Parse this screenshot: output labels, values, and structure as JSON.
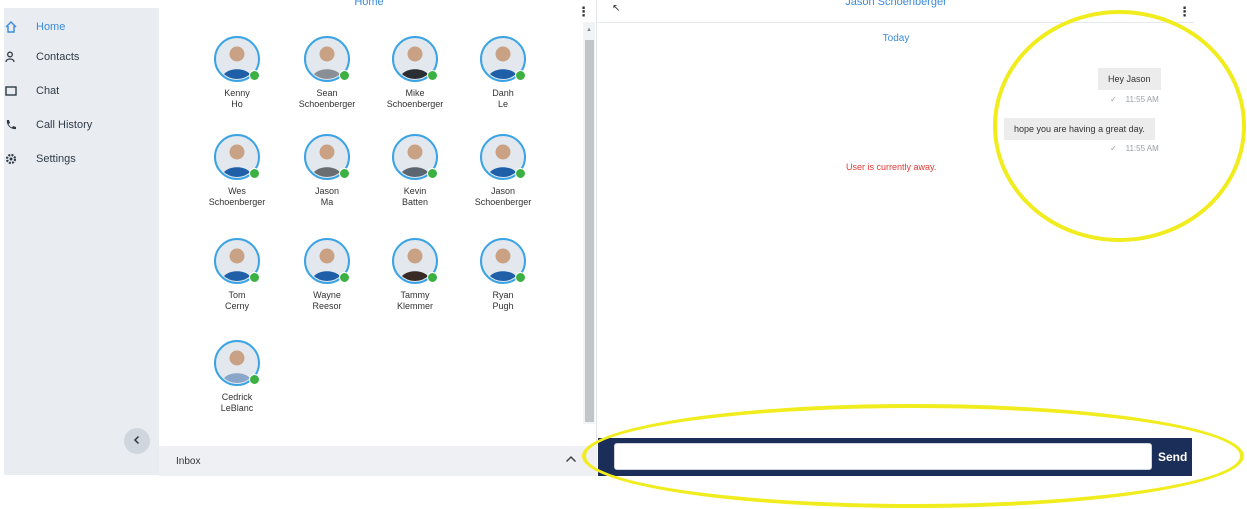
{
  "sidebar": {
    "items": [
      {
        "label": "Home",
        "icon": "home-icon",
        "active": true
      },
      {
        "label": "Contacts",
        "icon": "contacts-icon",
        "active": false
      },
      {
        "label": "Chat",
        "icon": "chat-icon",
        "active": false
      },
      {
        "label": "Call History",
        "icon": "phone-icon",
        "active": false
      },
      {
        "label": "Settings",
        "icon": "gear-icon",
        "active": false
      }
    ],
    "collapse_icon": "chevron-left-icon"
  },
  "middle": {
    "title": "Home",
    "contacts": [
      {
        "first": "Kenny",
        "last": "Ho"
      },
      {
        "first": "Sean",
        "last": "Schoenberger"
      },
      {
        "first": "Mike",
        "last": "Schoenberger"
      },
      {
        "first": "Danh",
        "last": "Le"
      },
      {
        "first": "Wes",
        "last": "Schoenberger"
      },
      {
        "first": "Jason",
        "last": "Ma"
      },
      {
        "first": "Kevin",
        "last": "Batten"
      },
      {
        "first": "Jason",
        "last": "Schoenberger"
      },
      {
        "first": "Tom",
        "last": "Cerny"
      },
      {
        "first": "Wayne",
        "last": "Reesor"
      },
      {
        "first": "Tammy",
        "last": "Klemmer"
      },
      {
        "first": "Ryan",
        "last": "Pugh"
      },
      {
        "first": "Cedrick",
        "last": "LeBlanc"
      }
    ],
    "inbox_label": "Inbox"
  },
  "chat": {
    "title": "Jason Schoenberger",
    "date_divider": "Today",
    "messages": [
      {
        "text": "Hey Jason",
        "time": "11:55 AM"
      },
      {
        "text": "hope you are having a great day.",
        "time": "11:55 AM"
      }
    ],
    "status_notice": "User is currently away.",
    "input_value": "",
    "send_label": "Send"
  },
  "colors": {
    "accent": "#3b8bd9",
    "online": "#3cb043",
    "compose_bg": "#1b2e5a",
    "highlight": "#f1ec1e",
    "away": "#e53935"
  }
}
